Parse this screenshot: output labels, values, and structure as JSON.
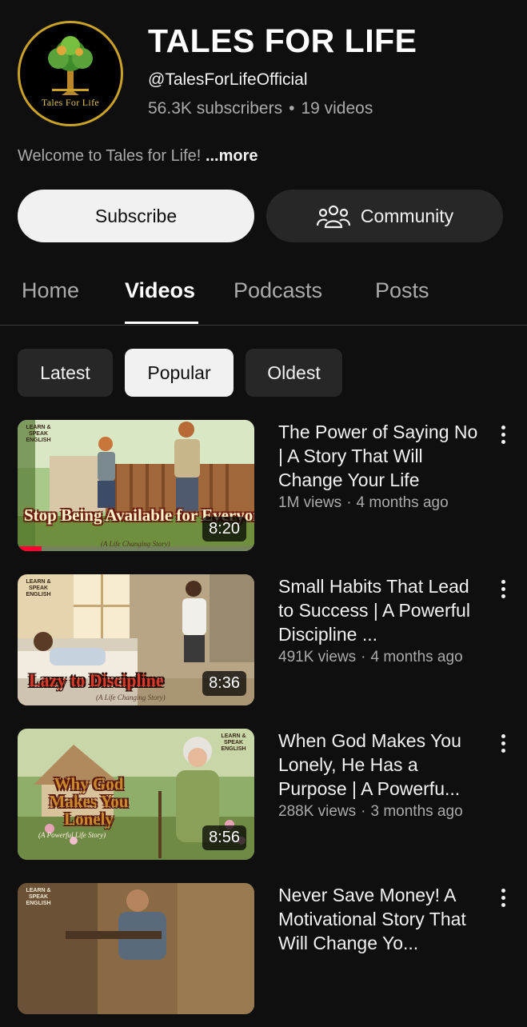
{
  "channel": {
    "logo_text": "Tales For Life",
    "title": "TALES FOR LIFE",
    "handle": "@TalesForLifeOfficial",
    "subscribers": "56.3K subscribers",
    "videos_count": "19 videos",
    "description": "Welcome to Tales for Life!",
    "more_label": "...more"
  },
  "actions": {
    "subscribe_label": "Subscribe",
    "community_label": "Community"
  },
  "tabs": [
    {
      "label": "Home",
      "active": false
    },
    {
      "label": "Videos",
      "active": true
    },
    {
      "label": "Podcasts",
      "active": false
    },
    {
      "label": "Posts",
      "active": false
    }
  ],
  "sort_chips": [
    {
      "label": "Latest",
      "selected": false
    },
    {
      "label": "Popular",
      "selected": true
    },
    {
      "label": "Oldest",
      "selected": false
    }
  ],
  "videos": [
    {
      "title": "The Power of Saying No | A Story That Will Change Your Life",
      "views": "1M views",
      "age": "4 months ago",
      "duration": "8:20",
      "thumb_badge": "LEARN & SPEAK ENGLISH",
      "thumb_title": "Stop Being Available for Everyone",
      "thumb_subtitle": "(A Life Changing Story)",
      "watched_fraction": 0.1
    },
    {
      "title": "Small Habits That Lead to Success | A Powerful Discipline ...",
      "views": "491K views",
      "age": "4 months ago",
      "duration": "8:36",
      "thumb_badge": "LEARN & SPEAK ENGLISH",
      "thumb_title": "Lazy to Discipline",
      "thumb_subtitle": "(A Life Changing Story)"
    },
    {
      "title": "When God Makes You Lonely, He Has a Purpose | A Powerfu...",
      "views": "288K views",
      "age": "3 months ago",
      "duration": "8:56",
      "thumb_badge": "LEARN & SPEAK ENGLISH",
      "thumb_title": "Why God Makes You Lonely",
      "thumb_subtitle": "(A Powerful Life Story)"
    },
    {
      "title": "Never Save Money! A Motivational Story That Will Change Yo...",
      "thumb_badge": "LEARN & SPEAK ENGLISH"
    }
  ],
  "colors": {
    "background": "#0f0f0f",
    "text_primary": "#f1f1f1",
    "text_secondary": "#aaaaaa",
    "chip_bg": "#272727",
    "progress": "#ff0033",
    "logo_gold": "#c9a227"
  }
}
